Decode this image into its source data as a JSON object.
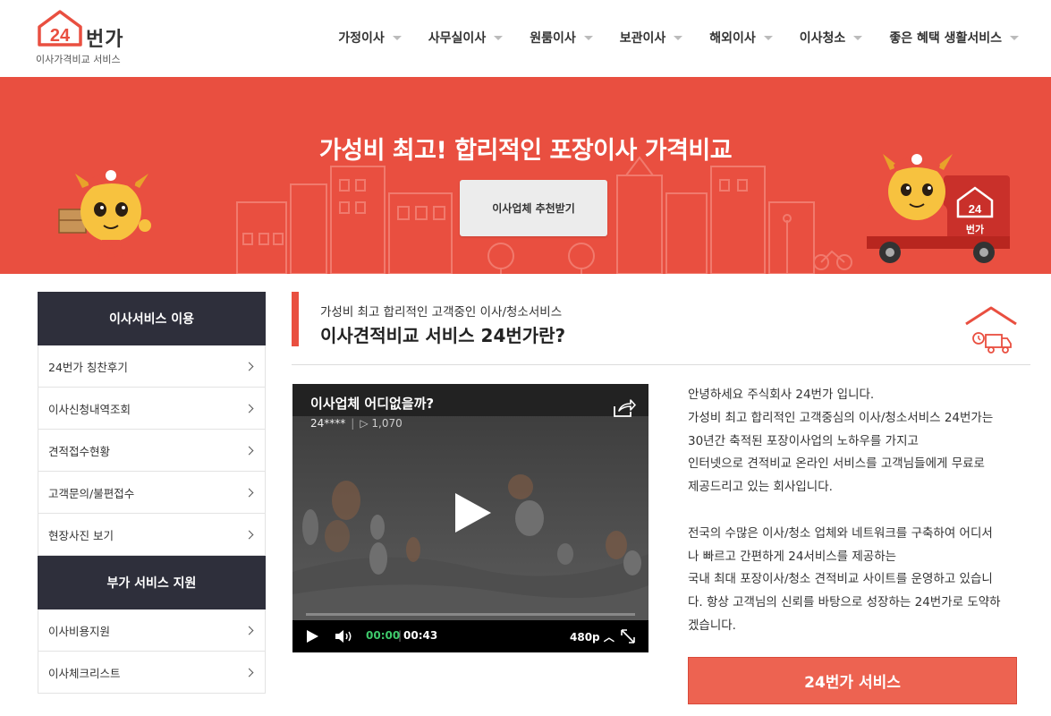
{
  "brand": {
    "logo_number": "24",
    "logo_word": "번가",
    "tagline": "이사가격비교 서비스",
    "accent_color": "#e94f40"
  },
  "nav": {
    "items": [
      {
        "label": "가정이사",
        "icon": "chevron-down-icon"
      },
      {
        "label": "사무실이사",
        "icon": "chevron-down-icon"
      },
      {
        "label": "원룸이사",
        "icon": "chevron-down-icon"
      },
      {
        "label": "보관이사",
        "icon": "chevron-down-icon"
      },
      {
        "label": "해외이사",
        "icon": "chevron-down-icon"
      },
      {
        "label": "이사청소",
        "icon": "chevron-down-icon"
      },
      {
        "label": "좋은 혜택 생활서비스",
        "icon": "chevron-down-icon"
      }
    ]
  },
  "hero": {
    "title": "가성비 최고! 합리적인 포장이사 가격비교",
    "button_label": "이사업체 추천받기",
    "truck_logo_number": "24",
    "truck_logo_word": "번가"
  },
  "sidebar": {
    "section1_title": "이사서비스 이용",
    "section1_items": [
      {
        "label": "24번가 칭찬후기"
      },
      {
        "label": "이사신청내역조회"
      },
      {
        "label": "견적접수현황"
      },
      {
        "label": "고객문의/불편접수"
      },
      {
        "label": "현장사진 보기"
      }
    ],
    "section2_title": "부가 서비스 지원",
    "section2_items": [
      {
        "label": "이사비용지원"
      },
      {
        "label": "이사체크리스트"
      }
    ]
  },
  "main": {
    "subtitle": "가성비 최고 합리적인 고객중인 이사/청소서비스",
    "title": "이사견적비교 서비스 24번가란?"
  },
  "video": {
    "title": "이사업체 어디없을까?",
    "channel": "24****",
    "views": "▷ 1,070",
    "time_current": "00:00",
    "time_total": "00:43",
    "quality": "480p ︿",
    "progress": 0
  },
  "description": {
    "paragraph1": [
      "안녕하세요 주식회사 24번가 입니다.",
      "가성비 최고 합리적인 고객중심의 이사/청소서비스 24번가는",
      "30년간 축적된 포장이사업의 노하우를 가지고",
      "인터넷으로 견적비교 온라인 서비스를 고객님들에게 무료로",
      "제공드리고 있는 회사입니다."
    ],
    "paragraph2": [
      "전국의 수많은 이사/청소 업체와 네트워크를 구축하여 어디서",
      "나 빠르고 간편하게 24서비스를 제공하는",
      "국내 최대 포장이사/청소 견적비교 사이트를 운영하고 있습니",
      "다. 항상 고객님의 신뢰를 바탕으로 성장하는 24번가로 도약하",
      "겠습니다."
    ]
  },
  "cta": {
    "label": "24번가 서비스"
  }
}
